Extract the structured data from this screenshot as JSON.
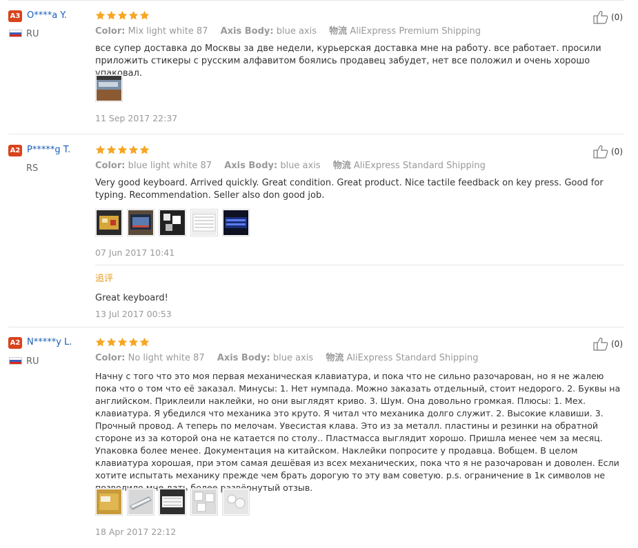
{
  "reviews": [
    {
      "badge": "A3",
      "user": "O****a Y.",
      "country": "RU",
      "flag": "ru",
      "rating": 5,
      "likes": "(0)",
      "color_label": "Color:",
      "color_value": "Mix light white 87",
      "axis_label": "Axis Body:",
      "axis_value": "blue axis",
      "ship_label": "物流",
      "ship_value": "AliExpress Premium Shipping",
      "text": "все супер доставка до Москвы за две недели, курьерская доставка мне на работу. все работает. просили приложить стикеры с русским алфавитом боялись продавец забудет, нет все положил и очень хорошо упаковал.",
      "photos": [
        "photo-keyboard-desk"
      ],
      "date": "11 Sep 2017 22:37"
    },
    {
      "badge": "A2",
      "user": "P*****g T.",
      "country": "RS",
      "flag": "",
      "rating": 5,
      "likes": "(0)",
      "color_label": "Color:",
      "color_value": "blue light white 87",
      "axis_label": "Axis Body:",
      "axis_value": "blue axis",
      "ship_label": "物流",
      "ship_value": "AliExpress Standard Shipping",
      "text": "Very good keyboard. Arrived quickly. Great condition. Great product. Nice tactile feedback on key press. Good for typing. Recommendation. Seller also don good job.",
      "photos": [
        "photo-package",
        "photo-keyboard-box",
        "photo-keycaps-dark",
        "photo-keyboard-white",
        "photo-keyboard-lit"
      ],
      "date": "07 Jun 2017 10:41",
      "additional": {
        "label": "追评",
        "text": "Great keyboard!",
        "date": "13 Jul 2017 00:53"
      }
    },
    {
      "badge": "A2",
      "user": "N*****y L.",
      "country": "RU",
      "flag": "ru",
      "rating": 5,
      "likes": "(0)",
      "color_label": "Color:",
      "color_value": "No light white 87",
      "axis_label": "Axis Body:",
      "axis_value": "blue axis",
      "ship_label": "物流",
      "ship_value": "AliExpress Standard Shipping",
      "text": "Начну с того что это моя первая механическая клавиатура, и пока что не сильно разочарован, но я не жалею пока что о том что её заказал. Минусы: 1. Нет нумпада. Можно заказать отдельный, стоит недорого. 2. Буквы на английском. Приклеили наклейки, но они выглядят криво. 3. Шум. Она довольно громкая. Плюсы: 1. Мех. клавиатура. Я убедился что механика это круто. Я читал что механика долго служит. 2. Высокие клавиши. 3. Прочный провод. А теперь по мелочам. Увесистая клава. Это из за металл. пластины и резинки на обратной стороне из за которой она не катается по столу.. Пластмасса выглядит хорошо. Пришла менее чем за месяц. Упаковка более менее. Документация на китайском. Наклейки попросите у продавца. Вобщем. В целом клавиатура хорошая, при этом самая дешёвая из всех механических, пока что я не разочарован и доволен. Если хотите испытать механику прежде чем брать дорогую то эту вам советую. p.s. ограничение в 1к символов не позволило мне дать более развёрнутый отзыв.",
      "photos": [
        "photo-parcel",
        "photo-keyboard-angle",
        "photo-keyboard-top",
        "photo-keycaps-white",
        "photo-keycaps-close"
      ],
      "date": "18 Apr 2017 22:12"
    }
  ],
  "colors": {
    "badge": "#d9431d",
    "user": "#1a5eb5",
    "star": "#f6a623",
    "muted": "#999999",
    "additional_label": "#e89a1c"
  }
}
